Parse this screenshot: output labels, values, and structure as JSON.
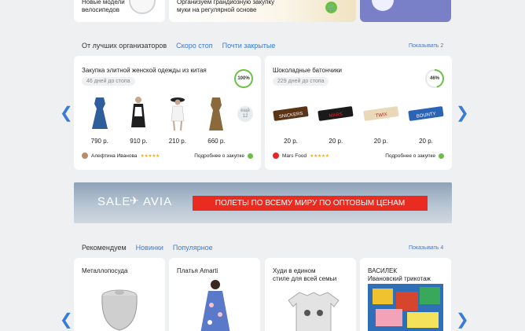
{
  "top_cards": [
    {
      "text_lines": [
        "Новые модели",
        "велосипедов"
      ]
    },
    {
      "text_lines": [
        "Организуем грандиозную закупку",
        "муки на регулярной основе"
      ]
    },
    {
      "text_lines": []
    }
  ],
  "organizers_section": {
    "tabs": [
      "От лучших организаторов",
      "Скоро стоп",
      "Почти закрытые"
    ],
    "show_more": "Показывать 2"
  },
  "purchases": [
    {
      "title": "Закупка элитной женской одежды из китая",
      "days_left": "46 дней до стопа",
      "progress_label": "100%",
      "progress": 1.0,
      "items": [
        {
          "price": "790 р."
        },
        {
          "price": "910 р."
        },
        {
          "price": "210 р."
        },
        {
          "price": "660 р."
        }
      ],
      "more_label_lines": [
        "ещё",
        "12"
      ],
      "organizer": "Алефтина Иванова",
      "rating": "★★★★★",
      "details": "Подробнее о закупке"
    },
    {
      "title": "Шоколадные батончики",
      "days_left": "229 дней до стопа",
      "progress_label": "46%",
      "progress": 0.46,
      "items": [
        {
          "price": "20 р.",
          "label": "SNICKERS"
        },
        {
          "price": "20 р.",
          "label": "MARS"
        },
        {
          "price": "20 р.",
          "label": "TWIX"
        },
        {
          "price": "20 р.",
          "label": "BOUNTY"
        }
      ],
      "organizer": "Mars Food",
      "rating": "★★★★★",
      "details": "Подробнее о закупке"
    }
  ],
  "banner": {
    "brand_left": "SALE",
    "brand_right": "AVIA",
    "slogan": "ПОЛЕТЫ ПО ВСЕМУ МИРУ ПО ОПТОВЫМ ЦЕНАМ"
  },
  "recommend_section": {
    "tabs": [
      "Рекомендуем",
      "Новинки",
      "Популярное"
    ],
    "show_more": "Показывать 4",
    "cards": [
      {
        "lines": [
          "Металлопосуда"
        ]
      },
      {
        "lines": [
          "Платья Amarti"
        ]
      },
      {
        "lines": [
          "Худи в едином",
          "стиле для всей семьи"
        ]
      },
      {
        "lines": [
          "ВАСИЛЕК",
          "Ивановский трикотаж"
        ]
      }
    ]
  },
  "colors": {
    "accent": "#3a7bd5",
    "green": "#6bbf47",
    "red": "#ea2b1f"
  }
}
